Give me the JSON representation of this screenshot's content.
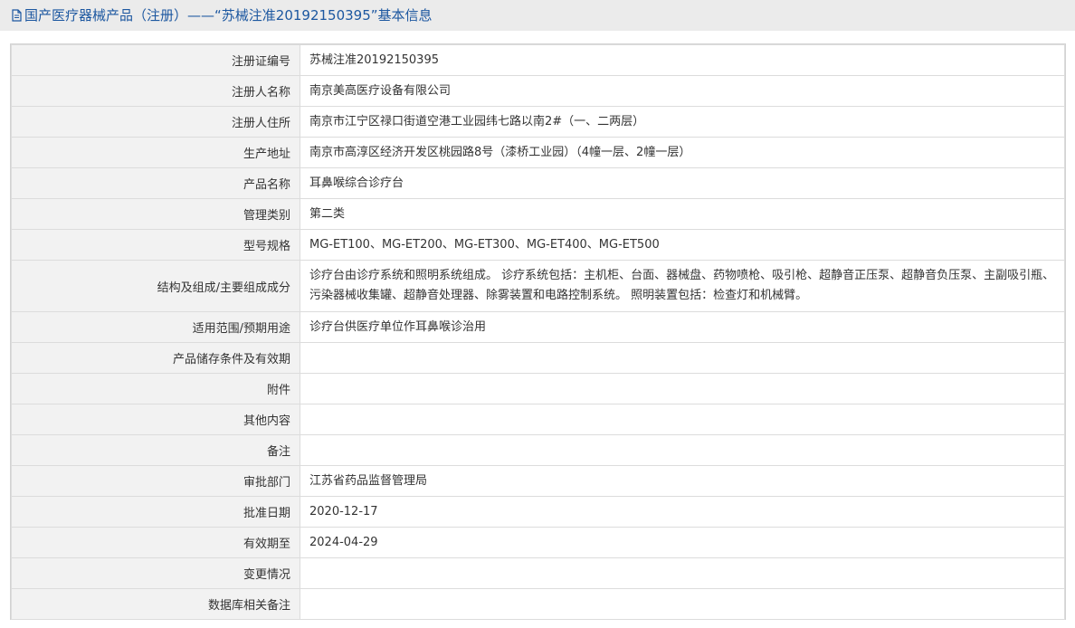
{
  "header": {
    "title": "国产医疗器械产品（注册）——“苏械注准20192150395”基本信息",
    "icon": "document-icon"
  },
  "rows": [
    {
      "label": "注册证编号",
      "value": "苏械注准20192150395"
    },
    {
      "label": "注册人名称",
      "value": "南京美高医疗设备有限公司"
    },
    {
      "label": "注册人住所",
      "value": "南京市江宁区禄口街道空港工业园纬七路以南2#（一、二两层）"
    },
    {
      "label": "生产地址",
      "value": "南京市高淳区经济开发区桃园路8号（漆桥工业园）（4幢一层、2幢一层）"
    },
    {
      "label": "产品名称",
      "value": "耳鼻喉综合诊疗台"
    },
    {
      "label": "管理类别",
      "value": "第二类"
    },
    {
      "label": "型号规格",
      "value": "MG-ET100、MG-ET200、MG-ET300、MG-ET400、MG-ET500"
    },
    {
      "label": "结构及组成/主要组成成分",
      "value": "诊疗台由诊疗系统和照明系统组成。 诊疗系统包括：主机柜、台面、器械盘、药物喷枪、吸引枪、超静音正压泵、超静音负压泵、主副吸引瓶、污染器械收集罐、超静音处理器、除雾装置和电路控制系统。 照明装置包括：检查灯和机械臂。"
    },
    {
      "label": "适用范围/预期用途",
      "value": "诊疗台供医疗单位作耳鼻喉诊治用"
    },
    {
      "label": "产品储存条件及有效期",
      "value": ""
    },
    {
      "label": "附件",
      "value": ""
    },
    {
      "label": "其他内容",
      "value": ""
    },
    {
      "label": "备注",
      "value": ""
    },
    {
      "label": "审批部门",
      "value": "江苏省药品监督管理局"
    },
    {
      "label": "批准日期",
      "value": "2020-12-17"
    },
    {
      "label": "有效期至",
      "value": "2024-04-29"
    },
    {
      "label": "变更情况",
      "value": ""
    },
    {
      "label": "数据库相关备注",
      "value": ""
    }
  ],
  "colors": {
    "title_text": "#1c57a0",
    "title_bg": "#ebebeb",
    "label_bg": "#f2f2f2",
    "border": "#dcdcdc"
  }
}
